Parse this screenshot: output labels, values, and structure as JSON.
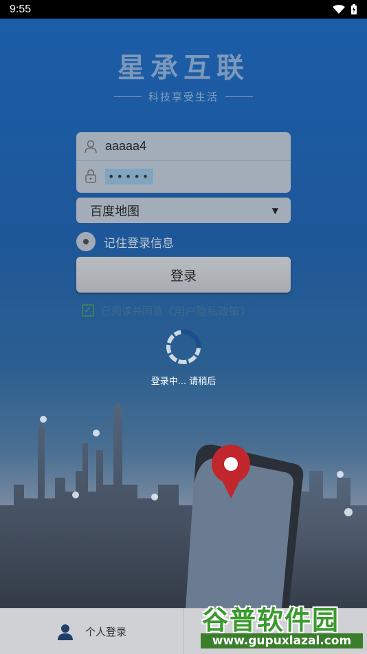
{
  "status_bar": {
    "time": "9:55"
  },
  "brand": {
    "title": "星承互联",
    "subtitle": "科技享受生活"
  },
  "login_form": {
    "username": "aaaaa4",
    "password_mask": "•••••",
    "map_provider": "百度地图",
    "remember_label": "记住登录信息",
    "login_button": "登录",
    "agree_prefix": "已阅读并同意",
    "agree_link": "《用户隐私政策》"
  },
  "loading": {
    "text": "登录中... 请稍后"
  },
  "bottom_nav": {
    "personal_login": "个人登录"
  },
  "watermark": {
    "main": "谷普软件园",
    "url": "www.gupuxlazal.com"
  },
  "colors": {
    "accent": "#1b5da8",
    "checkbox": "#3f7d5e",
    "watermark_green": "#3a9a2e"
  }
}
